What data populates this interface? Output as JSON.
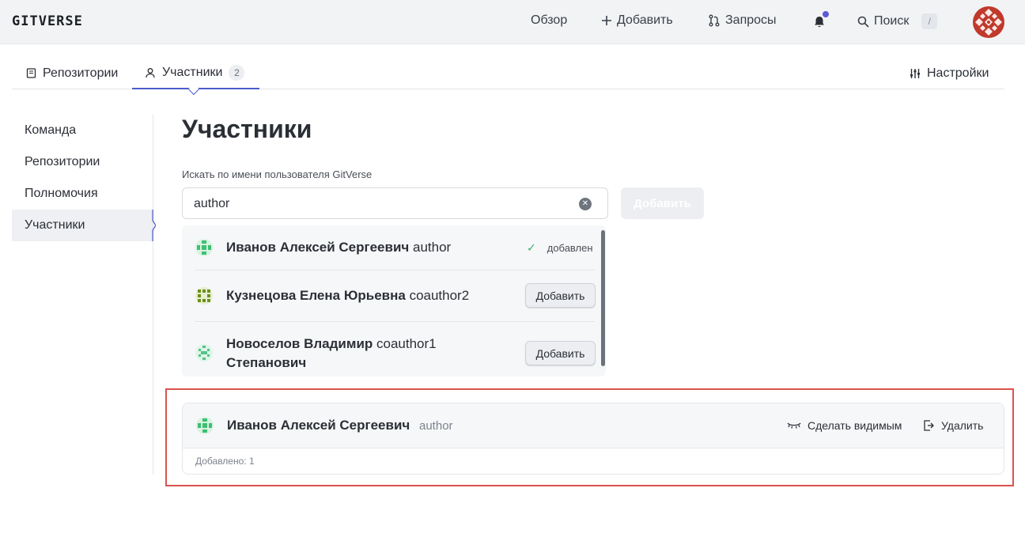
{
  "header": {
    "logo": "GITVERSE",
    "nav": [
      {
        "label": "Обзор",
        "icon": ""
      },
      {
        "label": "Добавить",
        "icon": "plus-icon"
      },
      {
        "label": "Запросы",
        "icon": "pull-request-icon"
      }
    ],
    "notifications_icon": "bell-icon",
    "search_label": "Поиск",
    "search_shortcut": "/",
    "accent_color": "#5b5bd6"
  },
  "tabs": [
    {
      "label": "Репозитории",
      "icon": "repo-icon"
    },
    {
      "label": "Участники",
      "icon": "user-icon",
      "count": "2",
      "active": true
    }
  ],
  "settings_label": "Настройки",
  "sidebar": {
    "items": [
      {
        "label": "Команда"
      },
      {
        "label": "Репозитории"
      },
      {
        "label": "Полномочия"
      },
      {
        "label": "Участники",
        "active": true
      }
    ]
  },
  "main": {
    "title": "Участники",
    "search_label": "Искать по имени пользователя GitVerse",
    "search_value": "author",
    "add_button": "Добавить"
  },
  "dropdown": {
    "results": [
      {
        "name": "Иванов Алексей Сергеевич",
        "login": "author",
        "status": "добавлен"
      },
      {
        "name": "Кузнецова Елена Юрьевна",
        "login": "coauthor2",
        "action": "Добавить"
      },
      {
        "name_line1": "Новоселов Владимир",
        "name_line2": "Степанович",
        "login": "coauthor1",
        "action": "Добавить"
      }
    ]
  },
  "members_card": {
    "name": "Иванов Алексей Сергеевич",
    "login": "author",
    "make_visible": "Сделать видимым",
    "remove": "Удалить",
    "footer": "Добавлено: 1"
  }
}
